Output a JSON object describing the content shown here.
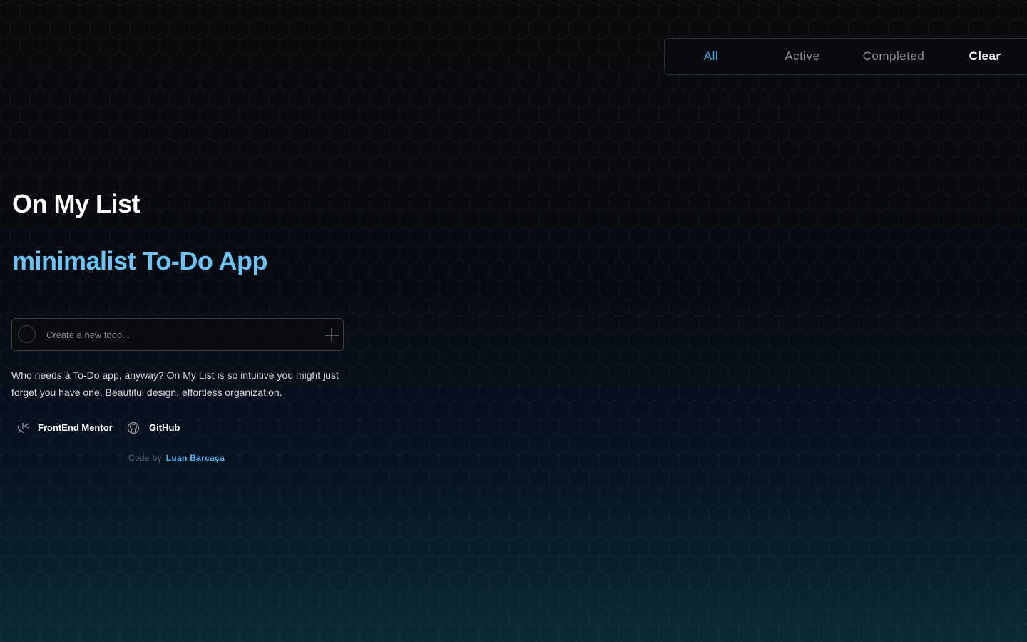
{
  "filters": {
    "all": "All",
    "active": "Active",
    "completed": "Completed",
    "clear": "Clear",
    "selected": "All"
  },
  "hero": {
    "title": "On My List",
    "subtitle": "minimalist To-Do App"
  },
  "todo_input": {
    "placeholder": "Create a new todo...",
    "value": ""
  },
  "description": "Who needs a To-Do app, anyway? On My List is so intuitive you might just forget you have one. Beautiful design, effortless organization.",
  "links": {
    "frontend_mentor": "FrontEnd Mentor",
    "github": "GitHub"
  },
  "credit": {
    "prefix": "Code by",
    "author": "Luan Barcaça"
  },
  "colors": {
    "accent_blue": "#3ea2e6",
    "subtitle_blue": "#6cc4f5",
    "background": "#0a0a0b",
    "gradient_bottom": "#0b2a35"
  },
  "icons": {
    "add": "plus-icon",
    "frontend_mentor": "frontend-mentor-icon",
    "github": "github-icon",
    "checkbox": "circle-checkbox-icon"
  }
}
